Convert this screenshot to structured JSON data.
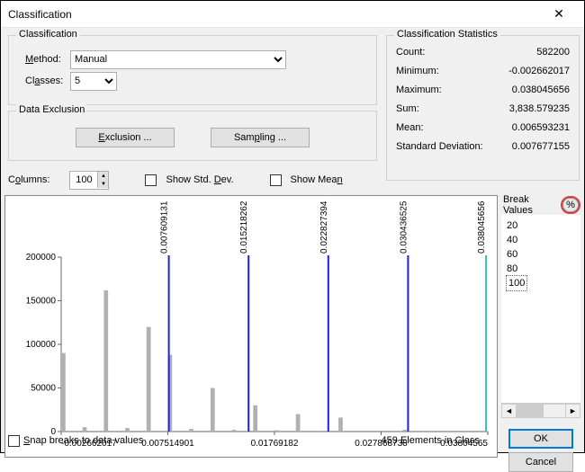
{
  "title": "Classification",
  "classification": {
    "legend": "Classification",
    "method_label": "Method:",
    "method_value": "Manual",
    "classes_label": "Classes:",
    "classes_value": "5"
  },
  "exclusion": {
    "legend": "Data Exclusion",
    "exclusion_btn": "Exclusion ...",
    "sampling_btn": "Sampling ..."
  },
  "stats": {
    "legend": "Classification Statistics",
    "rows": [
      {
        "k": "Count:",
        "v": "582200"
      },
      {
        "k": "Minimum:",
        "v": "-0.002662017"
      },
      {
        "k": "Maximum:",
        "v": "0.038045656"
      },
      {
        "k": "Sum:",
        "v": "3,838.579235"
      },
      {
        "k": "Mean:",
        "v": "0.006593231"
      },
      {
        "k": "Standard Deviation:",
        "v": "0.007677155"
      }
    ]
  },
  "columns": {
    "label": "Columns:",
    "value": "100",
    "show_std": "Show Std. Dev.",
    "show_mean": "Show Mean"
  },
  "break_values": {
    "title": "Break Values",
    "pct": "%",
    "items": [
      "20",
      "40",
      "60",
      "80",
      "100"
    ]
  },
  "buttons": {
    "ok": "OK",
    "cancel": "Cancel"
  },
  "footer": {
    "snap": "Snap breaks to data values",
    "count": "459 Elements in Class"
  },
  "chart_data": {
    "type": "bar",
    "xlabel": "",
    "ylabel": "",
    "ylim": [
      0,
      200000
    ],
    "y_ticks": [
      0,
      50000,
      100000,
      150000,
      200000
    ],
    "x_start": -0.002662017,
    "x_end": 0.03804565,
    "bar_width_x": 0.0004070777,
    "x_ticks": [
      -0.002662017,
      0.007514901,
      0.01769182,
      0.027868738,
      0.03804565
    ],
    "breaks": [
      {
        "x": 0.007609131,
        "label": "0.007609131"
      },
      {
        "x": 0.015218262,
        "label": "0.015218262"
      },
      {
        "x": 0.022827394,
        "label": "0.022827394"
      },
      {
        "x": 0.030436525,
        "label": "0.030436525"
      },
      {
        "x": 0.038045656,
        "label": "0.038045656"
      }
    ],
    "bars": [
      {
        "x": -0.002662017,
        "y": 90000
      },
      {
        "x": -0.000626629,
        "y": 5000
      },
      {
        "x": 0.00140876,
        "y": 162000
      },
      {
        "x": 0.003444148,
        "y": 4000
      },
      {
        "x": 0.005479537,
        "y": 120000
      },
      {
        "x": 0.007514925,
        "y": 88000
      },
      {
        "x": 0.009550314,
        "y": 3000
      },
      {
        "x": 0.011585702,
        "y": 50000
      },
      {
        "x": 0.013621091,
        "y": 2000
      },
      {
        "x": 0.015656479,
        "y": 30000
      },
      {
        "x": 0.017691868,
        "y": 1500
      },
      {
        "x": 0.019727256,
        "y": 20000
      },
      {
        "x": 0.021762645,
        "y": 1000
      },
      {
        "x": 0.023798034,
        "y": 16000
      },
      {
        "x": 0.029904199,
        "y": 2000
      }
    ]
  }
}
